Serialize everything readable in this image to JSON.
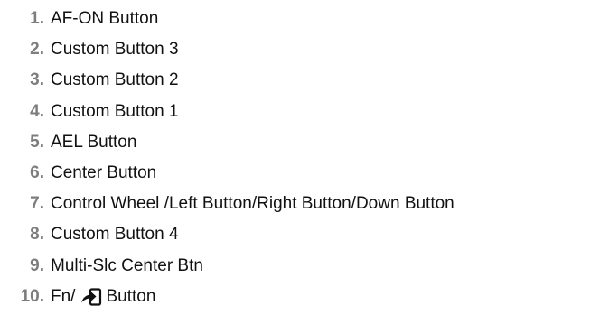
{
  "buttons": [
    {
      "number": "1.",
      "label": "AF-ON Button"
    },
    {
      "number": "2.",
      "label": "Custom Button 3"
    },
    {
      "number": "3.",
      "label": "Custom Button 2"
    },
    {
      "number": "4.",
      "label": "Custom Button 1"
    },
    {
      "number": "5.",
      "label": "AEL Button"
    },
    {
      "number": "6.",
      "label": "Center Button"
    },
    {
      "number": "7.",
      "label": "Control Wheel /Left Button/Right Button/Down Button"
    },
    {
      "number": "8.",
      "label": "Custom Button 4"
    },
    {
      "number": "9.",
      "label": "Multi-Slc Center Btn"
    },
    {
      "number": "10.",
      "label_prefix": "Fn/",
      "icon": "send-to-smartphone-icon",
      "label_suffix": "Button"
    }
  ],
  "colors": {
    "number": "#7d7d7d",
    "text": "#111111"
  }
}
